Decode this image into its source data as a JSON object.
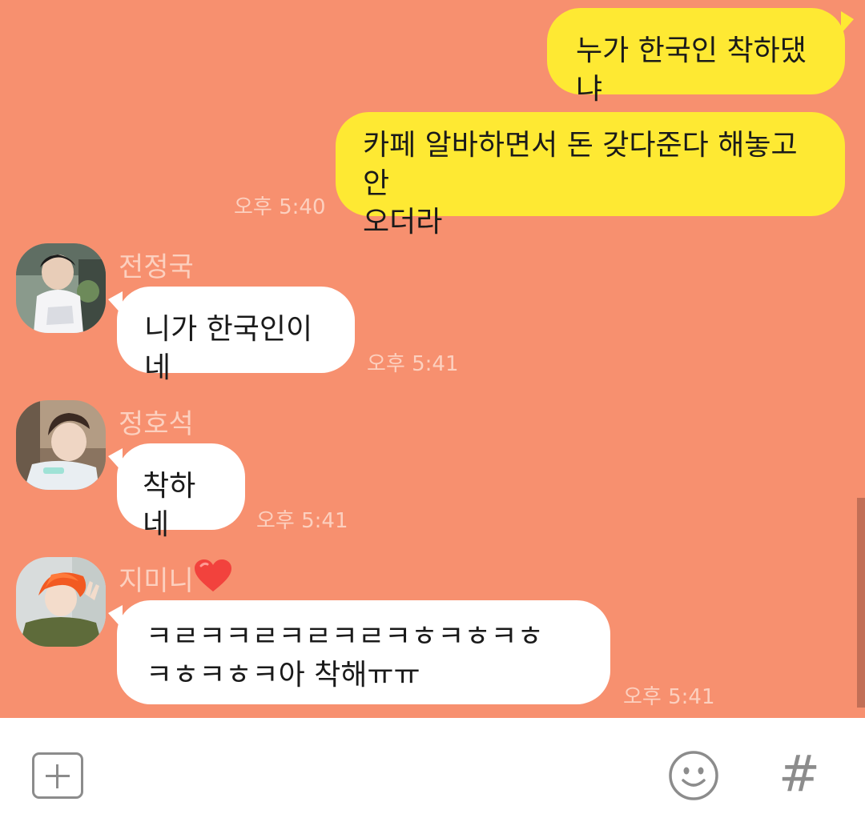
{
  "messages": [
    {
      "side": "mine",
      "text": "누가 한국인 착하댔냐"
    },
    {
      "side": "mine",
      "lines": [
        "카페 알바하면서 돈 갖다준다 해놓고 안",
        "오더라"
      ],
      "time": "오후 5:40"
    },
    {
      "side": "theirs",
      "sender": "전정국",
      "text": "니가 한국인이네",
      "time": "오후 5:41",
      "avatar": "jungkook-avatar"
    },
    {
      "side": "theirs",
      "sender": "정호석",
      "text": "착하네",
      "time": "오후 5:41",
      "avatar": "hoseok-avatar"
    },
    {
      "side": "theirs",
      "sender": "지미니",
      "lines": [
        "ㅋㄹㅋㅋㄹㅋㄹㅋㄹㅋㅎㅋㅎㅋㅎ",
        "ㅋㅎㅋㅎㅋ아 착해ㅠㅠ"
      ],
      "time": "오후 5:41",
      "avatar": "jimin-avatar",
      "sender_badge": "heart-icon"
    }
  ],
  "input_bar": {
    "plus_icon": "plus-icon",
    "emoji_icon": "emoji-icon",
    "hash_label": "#"
  },
  "colors": {
    "background": "#f7906f",
    "my_bubble": "#fee933",
    "their_bubble": "#ffffff",
    "meta_text": "#fcd0bf"
  }
}
